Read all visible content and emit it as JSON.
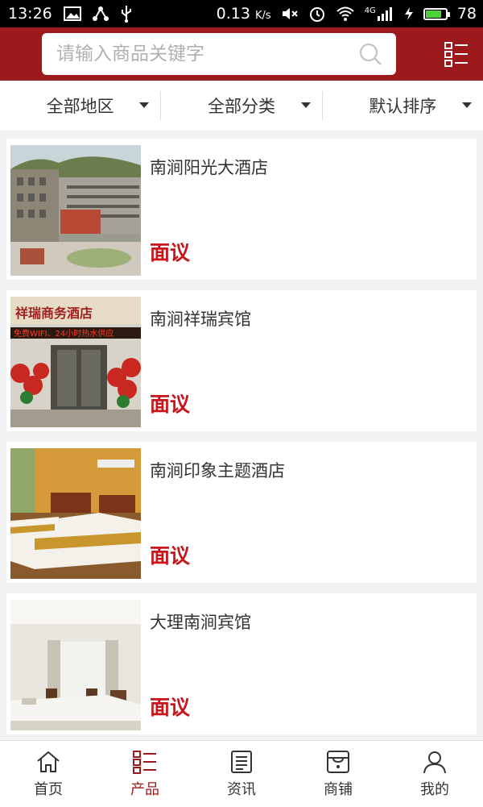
{
  "status_bar": {
    "time": "13:26",
    "network_speed": "0.13",
    "network_unit": "K/s",
    "cell_type": "4G",
    "battery": "78",
    "battery_level": 0.78
  },
  "header": {
    "search_placeholder": "请输入商品关键字"
  },
  "filters": [
    {
      "label": "全部地区"
    },
    {
      "label": "全部分类"
    },
    {
      "label": "默认排序"
    }
  ],
  "products": [
    {
      "title": "南涧阳光大酒店",
      "price": "面议",
      "image": "hotel-building-photo"
    },
    {
      "title": "南涧祥瑞宾馆",
      "price": "面议",
      "image": "hotel-entrance-photo",
      "sign_text": "祥瑞商务酒店",
      "ticker_text": "免费WIFI、24小时热水供应"
    },
    {
      "title": "南涧印象主题酒店",
      "price": "面议",
      "image": "hotel-room-photo"
    },
    {
      "title": "大理南涧宾馆",
      "price": "面议",
      "image": "hotel-room-photo"
    }
  ],
  "tabbar": [
    {
      "label": "首页",
      "icon": "home-icon",
      "active": false
    },
    {
      "label": "产品",
      "icon": "list-icon",
      "active": true
    },
    {
      "label": "资讯",
      "icon": "news-icon",
      "active": false
    },
    {
      "label": "商铺",
      "icon": "shop-icon",
      "active": false
    },
    {
      "label": "我的",
      "icon": "user-icon",
      "active": false
    }
  ],
  "colors": {
    "brand": "#9d1a1c",
    "price": "#c8161d"
  }
}
